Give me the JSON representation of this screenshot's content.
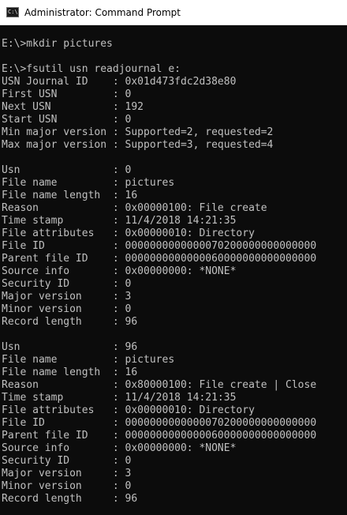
{
  "window": {
    "title": "Administrator: Command Prompt",
    "icon": "cmd-icon",
    "icon_glyph": "C:\\"
  },
  "console": {
    "lines": [
      "",
      "E:\\>mkdir pictures",
      "",
      "E:\\>fsutil usn readjournal e:",
      "USN Journal ID    : 0x01d473fdc2d38e80",
      "First USN         : 0",
      "Next USN          : 192",
      "Start USN         : 0",
      "Min major version : Supported=2, requested=2",
      "Max major version : Supported=3, requested=4",
      "",
      "Usn               : 0",
      "File name         : pictures",
      "File name length  : 16",
      "Reason            : 0x00000100: File create",
      "Time stamp        : 11/4/2018 14:21:35",
      "File attributes   : 0x00000010: Directory",
      "File ID           : 0000000000000070200000000000000",
      "Parent file ID    : 0000000000000060000000000000000",
      "Source info       : 0x00000000: *NONE*",
      "Security ID       : 0",
      "Major version     : 3",
      "Minor version     : 0",
      "Record length     : 96",
      "",
      "Usn               : 96",
      "File name         : pictures",
      "File name length  : 16",
      "Reason            : 0x80000100: File create | Close",
      "Time stamp        : 11/4/2018 14:21:35",
      "File attributes   : 0x00000010: Directory",
      "File ID           : 0000000000000070200000000000000",
      "Parent file ID    : 0000000000000060000000000000000",
      "Source info       : 0x00000000: *NONE*",
      "Security ID       : 0",
      "Major version     : 3",
      "Minor version     : 0",
      "Record length     : 96"
    ]
  }
}
